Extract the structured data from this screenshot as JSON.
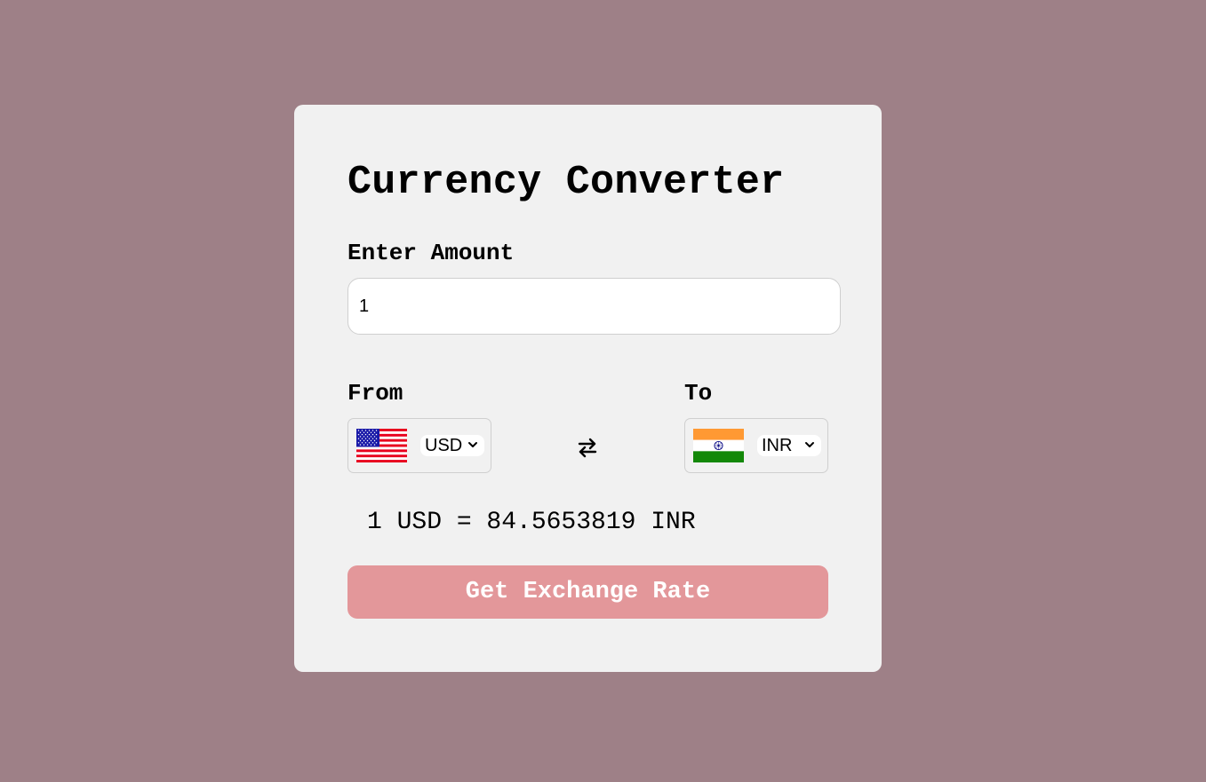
{
  "page": {
    "background_color": "#9e8087"
  },
  "card": {
    "title": "Currency Converter",
    "amount": {
      "label": "Enter Amount",
      "value": "1"
    },
    "from": {
      "label": "From",
      "currency": "USD",
      "flag_icon": "us-flag-icon"
    },
    "to": {
      "label": "To",
      "currency": "INR",
      "flag_icon": "india-flag-icon"
    },
    "swap_icon": "swap-arrows-icon",
    "result_text": "1 USD = 84.5653819 INR",
    "button_label": "Get Exchange Rate",
    "button_color": "#e3979a"
  }
}
